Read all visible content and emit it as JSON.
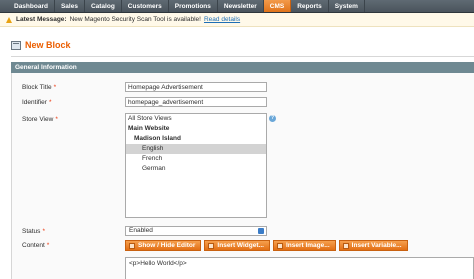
{
  "nav": {
    "items": [
      "Dashboard",
      "Sales",
      "Catalog",
      "Customers",
      "Promotions",
      "Newsletter",
      "CMS",
      "Reports",
      "System"
    ],
    "active": "CMS"
  },
  "notice": {
    "strong": "Latest Message:",
    "text": "New Magento Security Scan Tool is available!",
    "link": "Read details"
  },
  "page": {
    "title": "New Block"
  },
  "section": {
    "title": "General Information"
  },
  "form": {
    "block_title": {
      "label": "Block Title",
      "required": "*",
      "value": "Homepage Advertisement"
    },
    "identifier": {
      "label": "Identifier",
      "required": "*",
      "value": "homepage_advertisement"
    },
    "store_view": {
      "label": "Store View",
      "required": "*",
      "options": {
        "all": "All Store Views",
        "website": "Main Website",
        "store": "Madison Island",
        "views": [
          "English",
          "French",
          "German"
        ]
      },
      "selected": "English",
      "help_glyph": "?"
    },
    "status": {
      "label": "Status",
      "required": "*",
      "value": "Enabled"
    },
    "content": {
      "label": "Content",
      "required": "*",
      "value": "<p>Hello World</p>"
    }
  },
  "editor_buttons": [
    "Show / Hide Editor",
    "Insert Widget...",
    "Insert Image...",
    "Insert Variable..."
  ]
}
